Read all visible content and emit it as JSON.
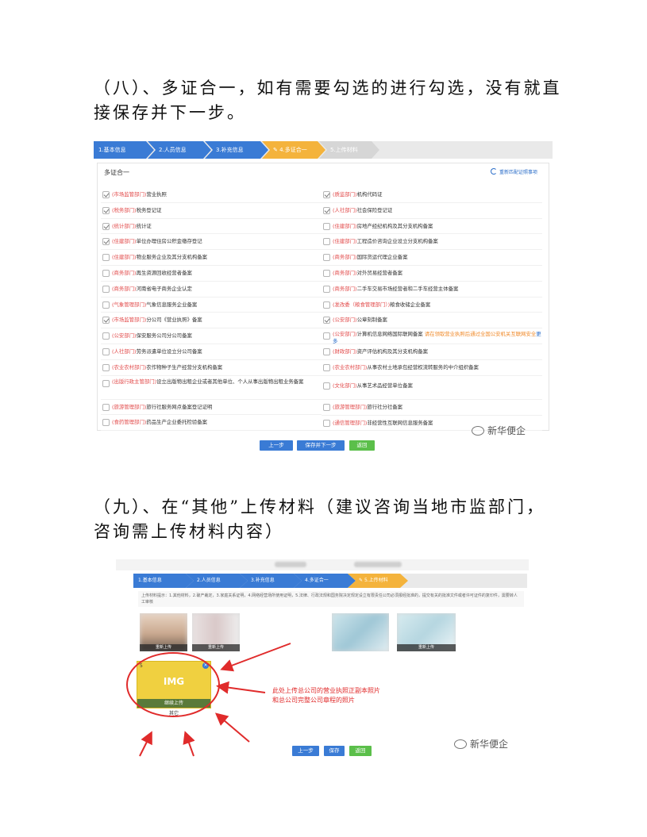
{
  "doc": {
    "heading8": "（八）、多证合一，如有需要勾选的进行勾选，没有就直接保存并下一步。",
    "heading9": "（九）、在“其他”上传材料（建议咨询当地市监部门，咨询需上传材料内容）"
  },
  "shot1": {
    "steps": [
      {
        "label": "1.基本信息",
        "state": "done"
      },
      {
        "label": "2.人员信息",
        "state": "done"
      },
      {
        "label": "3.补充信息",
        "state": "done"
      },
      {
        "label": "4.多证合一",
        "state": "active"
      },
      {
        "label": "5.上传材料",
        "state": "todo"
      }
    ],
    "panel_title": "多证合一",
    "refresh_label": "重新匹配证照事项",
    "left_items": [
      {
        "dept": "(市场监管部门)",
        "text": "营业执照",
        "checked": true
      },
      {
        "dept": "(税务部门)",
        "text": "税务登记证",
        "checked": true
      },
      {
        "dept": "(统计部门)",
        "text": "统计证",
        "checked": true
      },
      {
        "dept": "(住建部门)",
        "text": "单位办理住房公积金缴存登记",
        "checked": true
      },
      {
        "dept": "(住建部门)",
        "text": "物业服务企业及其分支机构备案",
        "checked": false
      },
      {
        "dept": "(商务部门)",
        "text": "再生资源回收经营者备案",
        "checked": false
      },
      {
        "dept": "(商务部门)",
        "text": "河南省电子商务企业认定",
        "checked": false
      },
      {
        "dept": "(气象管理部门)",
        "text": "气象信息服务企业备案",
        "checked": false
      },
      {
        "dept": "(市场监管部门)",
        "text": "分公司《营业执照》备案",
        "checked": true
      },
      {
        "dept": "(公安部门)",
        "text": "保安服务公司分公司备案",
        "checked": false
      },
      {
        "dept": "(人社部门)",
        "text": "劳务派遣单位设立分公司备案",
        "checked": false
      },
      {
        "dept": "(农业农村部门)",
        "text": "农作物种子生产经营分支机构备案",
        "checked": false
      },
      {
        "dept": "(出版行政主管部门)",
        "text": "设立出版物出租企业或者其他单位、个人从事出版物出租业务备案",
        "checked": false
      },
      {
        "dept": "(旅游管理部门)",
        "text": "旅行社服务网点备案登记证明",
        "checked": false
      },
      {
        "dept": "(食药管理部门)",
        "text": "药品生产企业委托检验备案",
        "checked": false
      }
    ],
    "right_items": [
      {
        "dept": "(质监部门)",
        "text": "机构代码证",
        "checked": true
      },
      {
        "dept": "(人社部门)",
        "text": "社会保险登记证",
        "checked": true
      },
      {
        "dept": "(住建部门)",
        "text": "房地产经纪机构及其分支机构备案",
        "checked": false
      },
      {
        "dept": "(住建部门)",
        "text": "工程造价咨询企业设立分支机构备案",
        "checked": false
      },
      {
        "dept": "(商务部门)",
        "text": "国际货运代理企业备案",
        "checked": false
      },
      {
        "dept": "(商务部门)",
        "text": "对外贸易经营者备案",
        "checked": false
      },
      {
        "dept": "(商务部门)",
        "text": "二手车交易市场经营者和二手车经营主体备案",
        "checked": false
      },
      {
        "dept": "(发改委（粮食管理部门）)",
        "text": "粮食收储企业备案",
        "checked": false
      },
      {
        "dept": "(公安部门)",
        "text": "公章刻制备案",
        "checked": true
      },
      {
        "dept": "(公安部门)",
        "text": "计算机信息网络国际联网备案",
        "checked": false,
        "note": "请在领取营业执照后通过全国公安机关互联网安全",
        "link": "更多"
      },
      {
        "dept": "(财政部门)",
        "text": "资产评估机构及其分支机构备案",
        "checked": false
      },
      {
        "dept": "(农业农村部门)",
        "text": "从事农村土地承包经营权流转服务的中介组织备案",
        "checked": false
      },
      {
        "dept": "(文化部门)",
        "text": "从事艺术品经营单位备案",
        "checked": false
      },
      {
        "dept": "(旅游管理部门)",
        "text": "旅行社分社备案",
        "checked": false
      },
      {
        "dept": "(通信管理部门)",
        "text": "非经营性互联网信息服务备案",
        "checked": false
      }
    ],
    "btn_prev": "上一步",
    "btn_save_next": "保存并下一步",
    "btn_back": "返回",
    "watermark": "新华便企"
  },
  "shot2": {
    "steps": [
      {
        "label": "1.基本信息",
        "state": "done"
      },
      {
        "label": "2.人员信息",
        "state": "done"
      },
      {
        "label": "3.补充信息",
        "state": "done"
      },
      {
        "label": "4.多证合一",
        "state": "done"
      },
      {
        "label": "5.上传材料",
        "state": "active"
      }
    ],
    "notice": "上传材料提示：1.其他材料，2.破产裁定，3.家庭关系证明，4.网络经营场所使用证明，5.法律、行政法规和国务院决定规定设立有限责任公司必须报经批准的，提交有关的批准文件或者许可证件的复印件，需要转人工审核",
    "thumb_caps": [
      "重新上传",
      "重新上传",
      "重新上传",
      "重新上传"
    ],
    "upload_num": "5",
    "upload_label": "IMG",
    "upload_caption": "继续上传",
    "upload_other": "其它",
    "annotation_line1": "此处上传总公司的营业执照正副本照片",
    "annotation_line2": "和总公司完整公司章程的照片",
    "btn_prev": "上一步",
    "btn_save": "保存",
    "btn_back": "返回",
    "watermark": "新华便企",
    "colors": {
      "blue": "#3a7bd5",
      "yellow": "#f4b33c",
      "arrow_red": "#e02b2b",
      "green": "#5bbf4a"
    }
  }
}
